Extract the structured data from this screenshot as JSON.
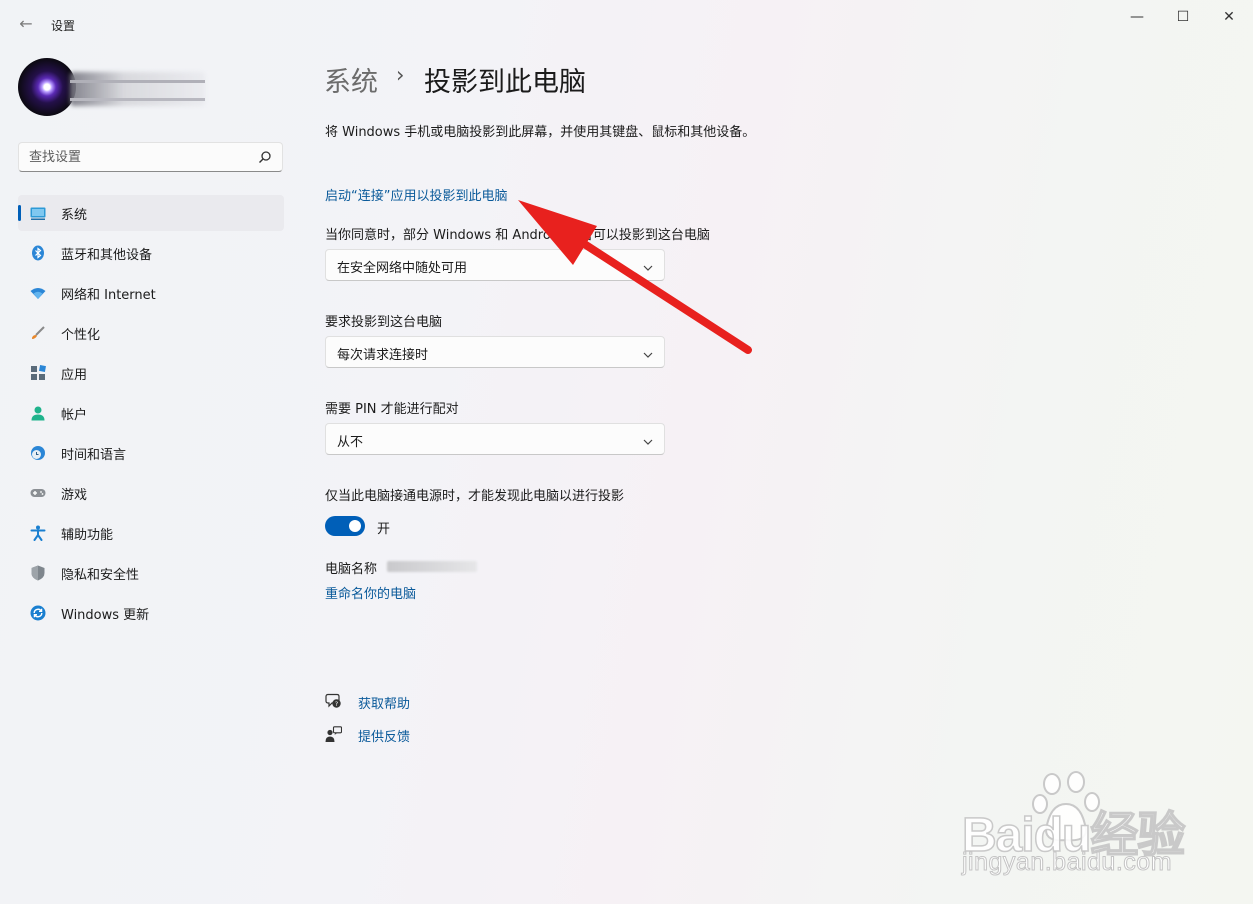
{
  "window": {
    "title": "设置",
    "controls": {
      "minimize": "—",
      "maximize": "☐",
      "close": "✕"
    }
  },
  "search": {
    "placeholder": "查找设置",
    "value": ""
  },
  "sidebar": {
    "items": [
      {
        "label": "系统",
        "icon": "system-icon",
        "active": true
      },
      {
        "label": "蓝牙和其他设备",
        "icon": "bluetooth-icon"
      },
      {
        "label": "网络和 Internet",
        "icon": "wifi-icon"
      },
      {
        "label": "个性化",
        "icon": "brush-icon"
      },
      {
        "label": "应用",
        "icon": "apps-icon"
      },
      {
        "label": "帐户",
        "icon": "account-icon"
      },
      {
        "label": "时间和语言",
        "icon": "time-language-icon"
      },
      {
        "label": "游戏",
        "icon": "gamepad-icon"
      },
      {
        "label": "辅助功能",
        "icon": "accessibility-icon"
      },
      {
        "label": "隐私和安全性",
        "icon": "shield-icon"
      },
      {
        "label": "Windows 更新",
        "icon": "update-icon"
      }
    ]
  },
  "breadcrumb": {
    "parent": "系统",
    "separator": "›",
    "current": "投影到此电脑"
  },
  "main": {
    "description": "将 Windows 手机或电脑投影到此屏幕，并使用其键盘、鼠标和其他设备。",
    "launch_link": "启动“连接”应用以投影到此电脑",
    "setting1": {
      "label": "当你同意时，部分 Windows 和 Android 设备可以投影到这台电脑",
      "value": "在安全网络中随处可用"
    },
    "setting2": {
      "label": "要求投影到这台电脑",
      "value": "每次请求连接时"
    },
    "setting3": {
      "label": "需要 PIN 才能进行配对",
      "value": "从不"
    },
    "setting4": {
      "label": "仅当此电脑接通电源时，才能发现此电脑以进行投影",
      "toggle_state": "开",
      "toggle_on": true
    },
    "pc_name_label": "电脑名称",
    "rename_link": "重命名你的电脑",
    "help_link": "获取帮助",
    "feedback_link": "提供反馈"
  },
  "watermark": {
    "logo": "Baidu经验",
    "url": "jingyan.baidu.com"
  },
  "colors": {
    "accent": "#005fb8",
    "link": "#0a5a9a",
    "arrow": "#e8211e"
  }
}
